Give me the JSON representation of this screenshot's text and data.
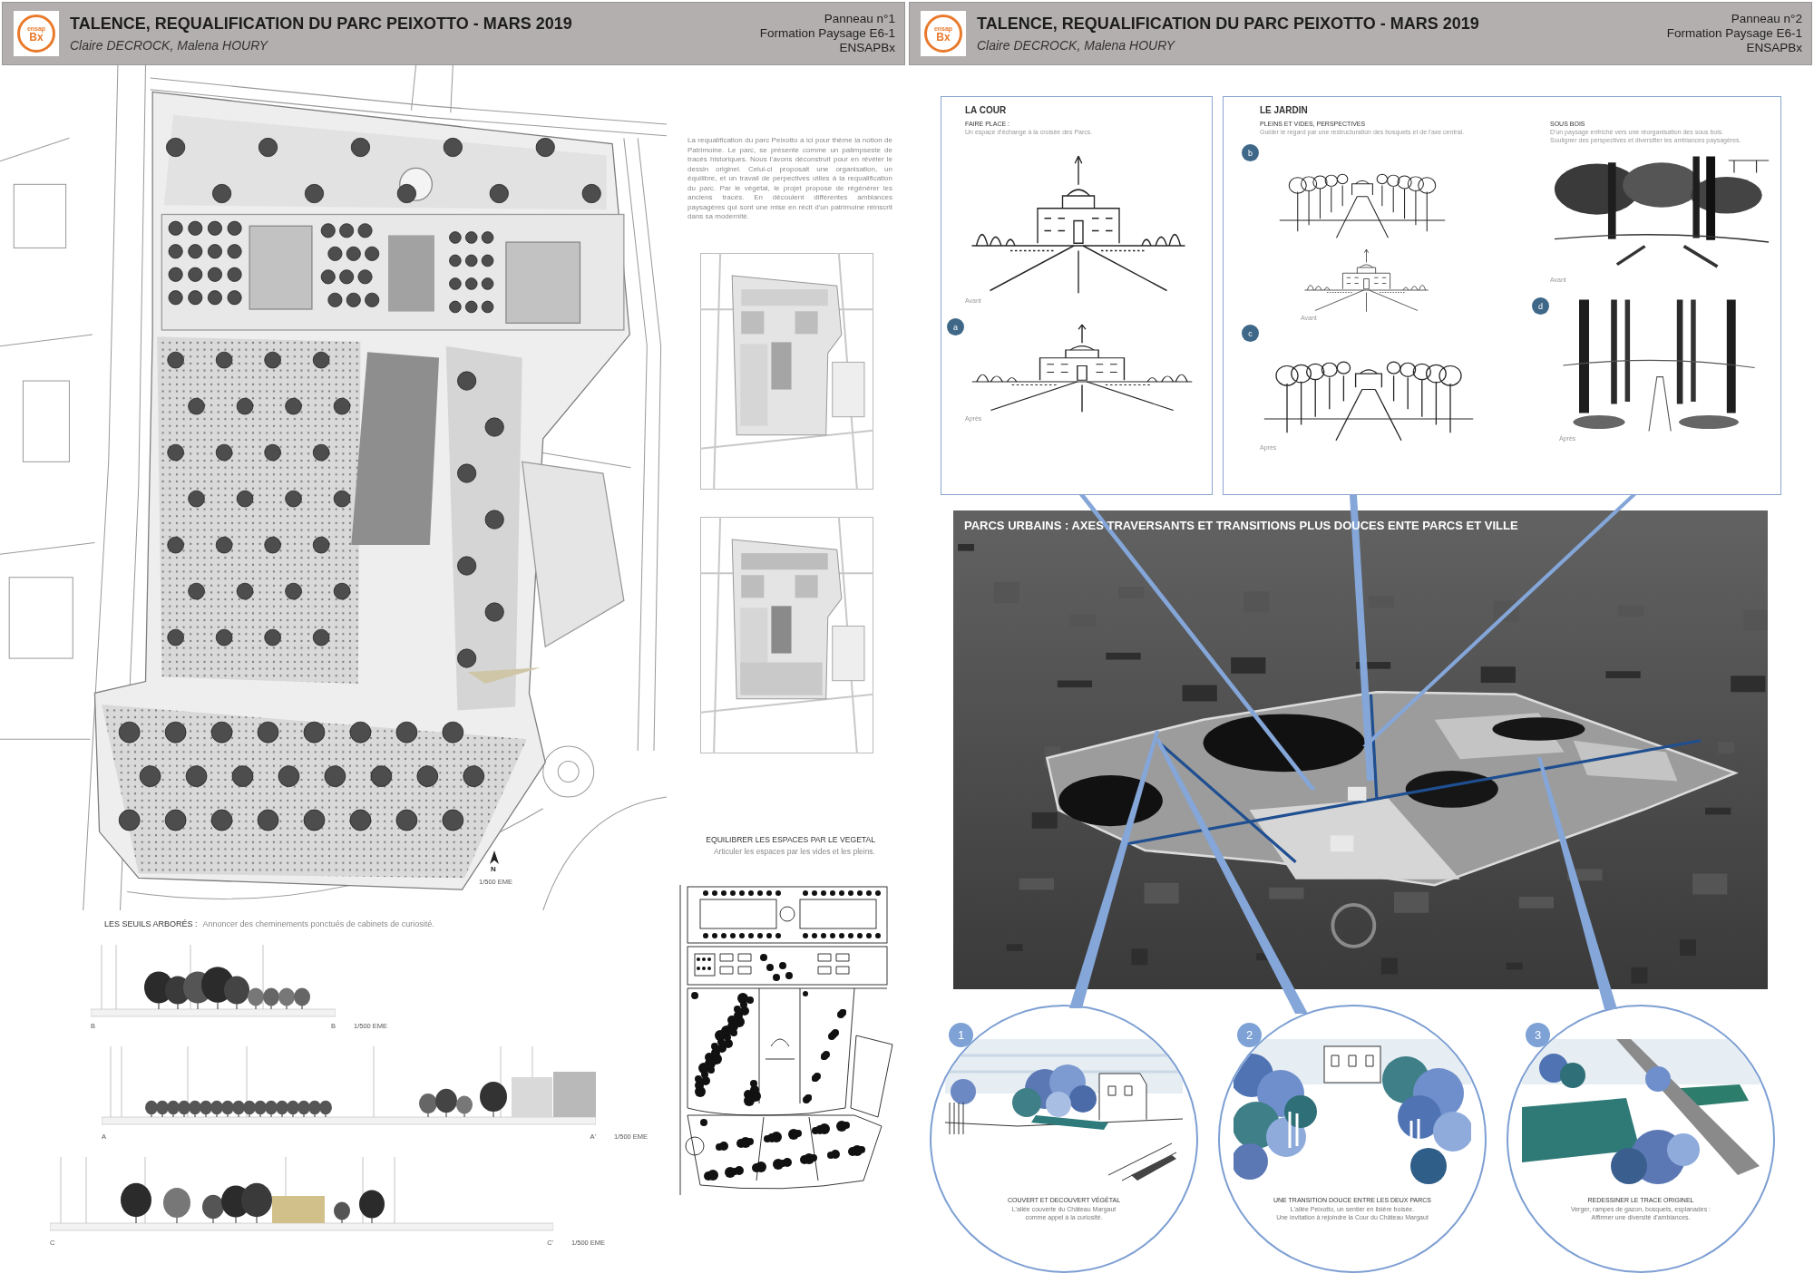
{
  "left_panel": {
    "header": {
      "logo": {
        "top": "ensap",
        "bottom": "Bx"
      },
      "title": "TALENCE, REQUALIFICATION DU PARC PEIXOTTO - MARS 2019",
      "authors": "Claire DECROCK, Malena HOURY",
      "meta": [
        "Panneau n°1",
        "Formation Paysage E6-1",
        "ENSAPBx"
      ]
    },
    "site_plan": {
      "north": "N",
      "scale": "1/500 EME"
    },
    "intro": "La requalification du parc Peixotto a ici pour thème la notion de Patrimoine. Le parc, se présente comme un palimpseste de tracés historiques. Nous l'avons déconstruit pour en révéler le dessin originel. Celui-ci proposait une organisation, un équilibre, et un travail de perpectives utiles à la requalification du parc. Par le végétal, le projet propose de régénérer les anciens tracés. En découlent différentes ambiances paysagères qui sont une mise en récit d'un patrimoine réinscrit dans sa modernité.",
    "sections": {
      "title": "LES SEUILS ARBORÉS :",
      "subtitle": "Annoncer des cheminements ponctués de cabinets de curiosité.",
      "items": [
        {
          "start": "B",
          "end": "B",
          "scale": "1/500 EME"
        },
        {
          "start": "A",
          "end": "A'",
          "scale": "1/500 EME"
        },
        {
          "start": "C",
          "end": "C'",
          "scale": "1/500 EME"
        }
      ]
    },
    "vegetation": {
      "title": "EQUILIBRER LES ESPACES PAR LE VEGETAL",
      "subtitle": "Articuler les espaces par les vides et les pleins."
    }
  },
  "right_panel": {
    "header": {
      "logo": {
        "top": "ensap",
        "bottom": "Bx"
      },
      "title": "TALENCE, REQUALIFICATION DU PARC PEIXOTTO - MARS 2019",
      "authors": "Claire DECROCK, Malena HOURY",
      "meta": [
        "Panneau n°2",
        "Formation Paysage E6-1",
        "ENSAPBx"
      ]
    },
    "sketch_boxes": [
      {
        "title": "LA COUR",
        "groups": [
          {
            "heading": "FAIRE PLACE :",
            "text": [
              "Un espace d'échange à la croisée des Parcs."
            ],
            "sketches": [
              {
                "kind": "chateau",
                "label": "Avant"
              },
              {
                "kind": "chateau",
                "badge": "a",
                "label": "Après"
              }
            ]
          }
        ]
      },
      {
        "title": "LE JARDIN",
        "groups": [
          {
            "heading": "PLEINS ET VIDES, PERSPECTIVES",
            "text": [
              "Guider le regard par une restructuration des bosquets et de l'axe central."
            ],
            "sketches": [
              {
                "kind": "avenue",
                "badge": "b"
              },
              {
                "kind": "chateau",
                "label": "Avant"
              },
              {
                "kind": "avenue",
                "badge": "c",
                "label": "Après"
              }
            ]
          },
          {
            "heading": "SOUS BOIS",
            "text": [
              "D'un paysage enfriché vers une réorganisation des sous bois.",
              "Souligner des perspectives et diversifier les ambiances paysagères."
            ],
            "sketches": [
              {
                "kind": "woods",
                "label": "Avant"
              },
              {
                "kind": "trunks",
                "badge": "d",
                "label": "Après"
              }
            ]
          }
        ]
      }
    ],
    "aerial": {
      "title": "PARCS URBAINS : AXES TRAVERSANTS ET TRANSITIONS PLUS DOUCES ENTE PARCS ET VILLE"
    },
    "vignettes": [
      {
        "number": "1",
        "kind": "building",
        "title": "COUVERT ET DECOUVERT VÉGÉTAL",
        "lines": [
          "L'allée couverte du Château Margaut",
          "comme appel à la curiosité."
        ]
      },
      {
        "number": "2",
        "kind": "avenue",
        "title": "UNE TRANSITION DOUCE ENTRE LES DEUX PARCS",
        "lines": [
          "L'allée Peixotto, un sentier en lisière boisée.",
          "Une invitation à rejoindre la Cour du Château Margaut"
        ]
      },
      {
        "number": "3",
        "kind": "lawns",
        "title": "REDESSINER LE TRACE ORIGINEL",
        "lines": [
          "Verger, rampes de gazon, bosquets, esplanades :",
          "Affirmer une diversité d'ambiances."
        ]
      }
    ]
  }
}
